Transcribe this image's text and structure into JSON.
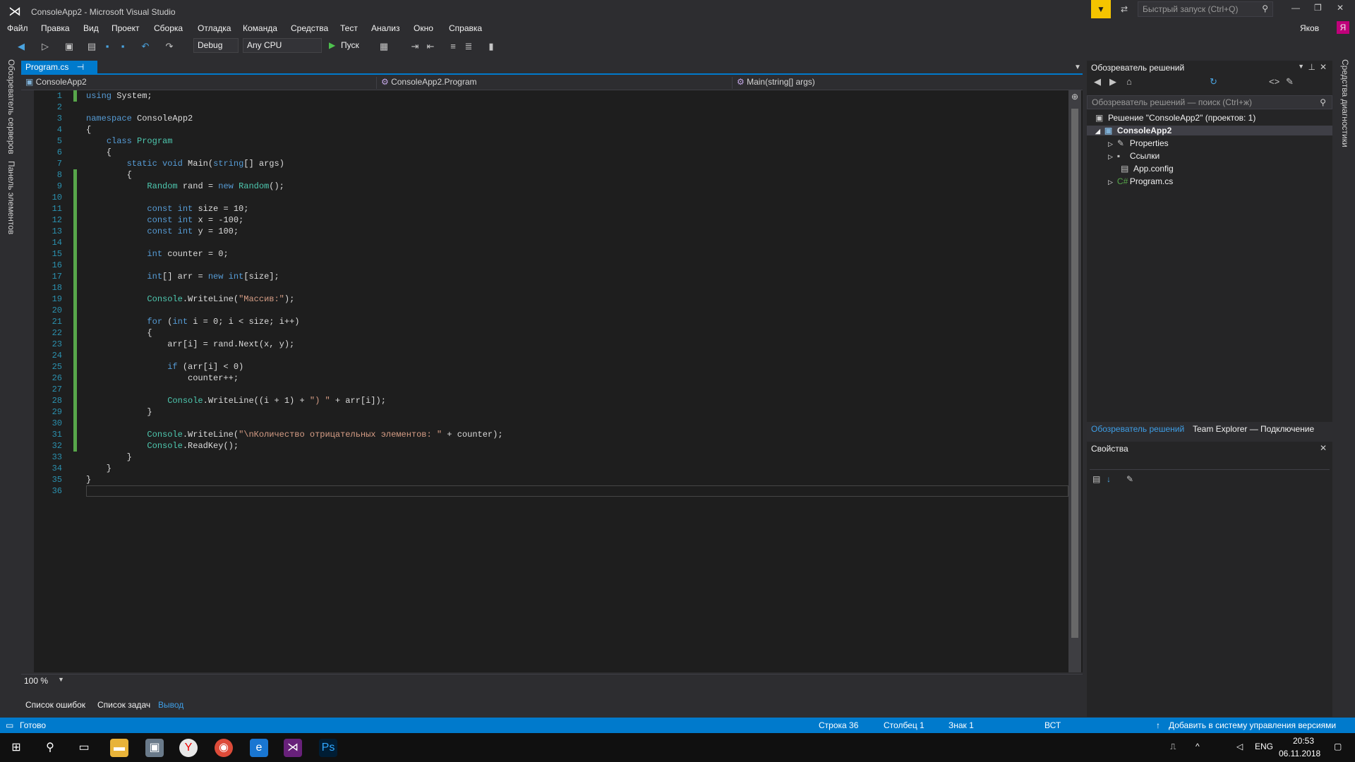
{
  "window": {
    "title": "ConsoleApp2 - Microsoft Visual Studio",
    "quick_launch_placeholder": "Быстрый запуск (Ctrl+Q)",
    "user": "Яков",
    "user_badge": "Я"
  },
  "menu": [
    "Файл",
    "Правка",
    "Вид",
    "Проект",
    "Сборка",
    "Отладка",
    "Команда",
    "Средства",
    "Тест",
    "Анализ",
    "Окно",
    "Справка"
  ],
  "toolbar": {
    "configuration": "Debug",
    "platform": "Any CPU",
    "start_label": "Пуск"
  },
  "left_strip": {
    "server_explorer": "Обозреватель серверов",
    "toolbox": "Панель элементов"
  },
  "right_strip": {
    "diagnostics": "Средства диагностики"
  },
  "editor": {
    "tab_label": "Program.cs",
    "nav_project": "ConsoleApp2",
    "nav_class": "ConsoleApp2.Program",
    "nav_member": "Main(string[] args)",
    "zoom": "100 %",
    "line_numbers": [
      "1",
      "2",
      "3",
      "4",
      "5",
      "6",
      "7",
      "8",
      "9",
      "10",
      "11",
      "12",
      "13",
      "14",
      "15",
      "16",
      "17",
      "18",
      "19",
      "20",
      "21",
      "22",
      "23",
      "24",
      "25",
      "26",
      "27",
      "28",
      "29",
      "30",
      "31",
      "32",
      "33",
      "34",
      "35",
      "36"
    ]
  },
  "bottom_tabs": {
    "errors": "Список ошибок",
    "tasks": "Список задач",
    "output": "Вывод"
  },
  "solution_explorer": {
    "title": "Обозреватель решений",
    "search_placeholder": "Обозреватель решений — поиск (Ctrl+ж)",
    "solution": "Решение \"ConsoleApp2\" (проектов: 1)",
    "project": "ConsoleApp2",
    "items": [
      "Properties",
      "Ссылки",
      "App.config",
      "Program.cs"
    ],
    "tab_solution": "Обозреватель решений",
    "tab_team": "Team Explorer — Подключение"
  },
  "properties": {
    "title": "Свойства"
  },
  "status": {
    "ready": "Готово",
    "row": "Строка 36",
    "col": "Столбец 1",
    "char": "Знак 1",
    "mode": "ВСТ",
    "source_control": "Добавить в систему управления версиями"
  },
  "taskbar": {
    "lang": "ENG",
    "time": "20:53",
    "date": "06.11.2018"
  },
  "colors": {
    "accent": "#007acc",
    "editor_bg": "#1e1e1e",
    "keyword": "#569cd6",
    "type": "#4ec9b0",
    "string": "#d69d85"
  }
}
